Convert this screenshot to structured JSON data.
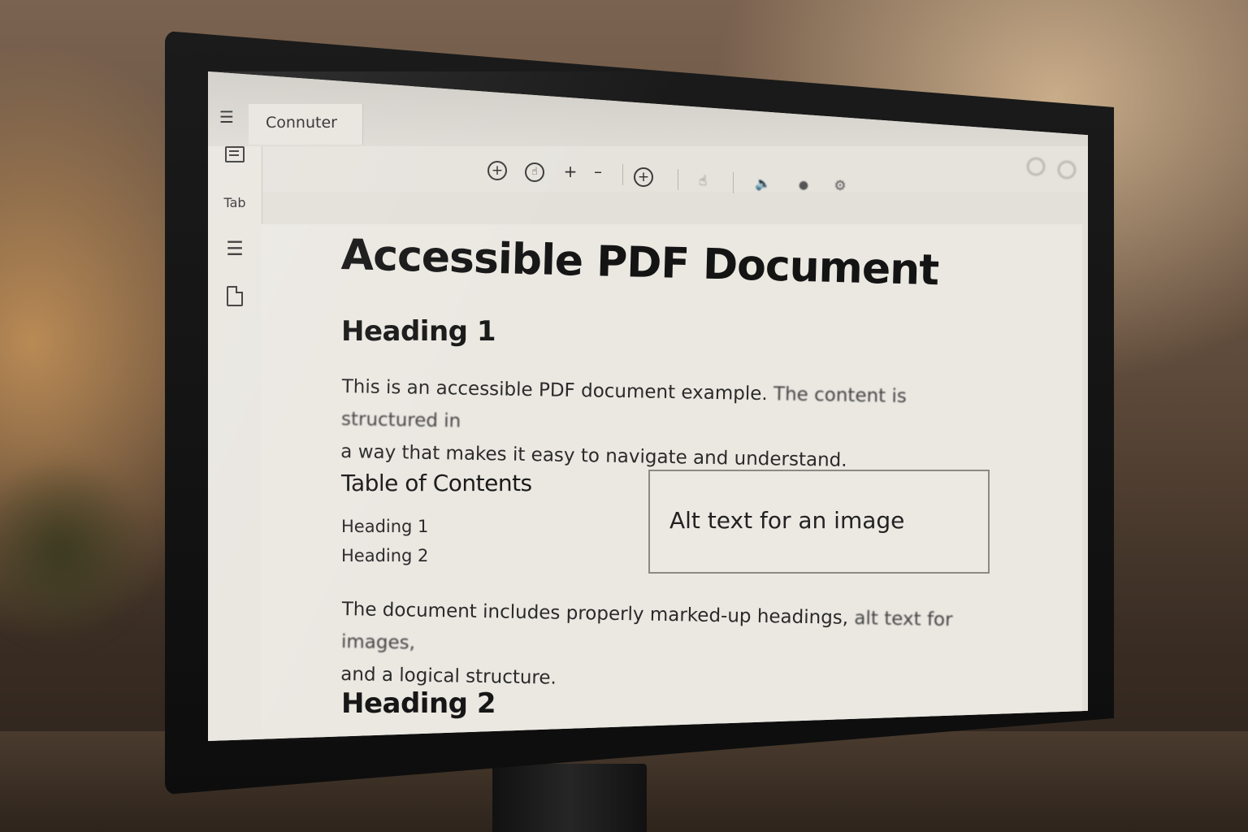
{
  "window": {
    "app_tab_title": "Connuter"
  },
  "sidebar": {
    "tab_label": "Tab"
  },
  "toolbar": {
    "items": [
      {
        "icon": "zoom-in-circle-icon",
        "glyph": "+"
      },
      {
        "icon": "hand-tool-icon",
        "glyph": "☝"
      },
      {
        "icon": "plus-icon",
        "glyph": "+"
      },
      {
        "icon": "minus-icon",
        "glyph": "–"
      },
      {
        "icon": "add-circle-icon",
        "glyph": "+"
      },
      {
        "icon": "touch-icon",
        "glyph": "☝"
      },
      {
        "icon": "read-aloud-icon",
        "glyph": "🔈"
      },
      {
        "icon": "mic-icon",
        "glyph": "●"
      },
      {
        "icon": "settings-icon",
        "glyph": "⚙"
      }
    ]
  },
  "document": {
    "title": "Accessible PDF Document",
    "heading1": "Heading 1",
    "paragraph1_main": "This is an accessible PDF document example. ",
    "paragraph1_faded": "The content is structured in",
    "paragraph1_line2": "a way that makes it easy to navigate and understand.",
    "toc_heading": "Table of Contents",
    "toc_items": [
      "Heading 1",
      "Heading 2"
    ],
    "image_alt_text": "Alt text for an image",
    "paragraph2_main": "The document includes properly marked-up headings, ",
    "paragraph2_faded": "alt text for images,",
    "paragraph2_line2": "and a logical structure.",
    "heading2": "Heading 2"
  },
  "colors": {
    "screen_bg": "#e3e0d9",
    "text": "#141414",
    "bezel": "#0d0d0d"
  }
}
